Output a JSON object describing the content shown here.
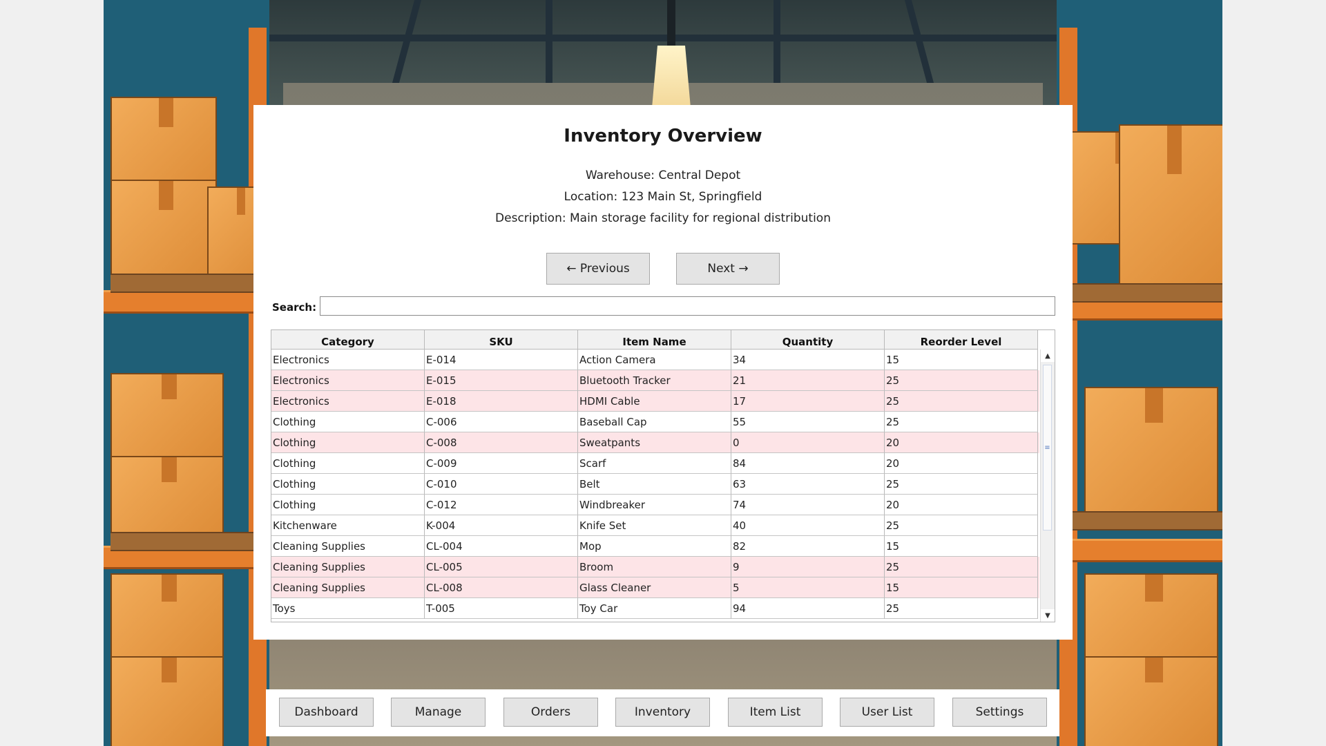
{
  "panel": {
    "title": "Inventory Overview",
    "warehouse": "Warehouse: Central Depot",
    "location": "Location: 123 Main St, Springfield",
    "description": "Description: Main storage facility for regional distribution",
    "prev_label": "← Previous",
    "next_label": "Next →",
    "search_label": "Search:",
    "search_value": ""
  },
  "table": {
    "columns": [
      "Category",
      "SKU",
      "Item Name",
      "Quantity",
      "Reorder Level"
    ],
    "rows": [
      {
        "category": "Electronics",
        "sku": "E-014",
        "name": "Action Camera",
        "qty": "34",
        "reorder": "15",
        "status": "ok"
      },
      {
        "category": "Electronics",
        "sku": "E-015",
        "name": "Bluetooth Tracker",
        "qty": "21",
        "reorder": "25",
        "status": "low"
      },
      {
        "category": "Electronics",
        "sku": "E-018",
        "name": "HDMI Cable",
        "qty": "17",
        "reorder": "25",
        "status": "low"
      },
      {
        "category": "Clothing",
        "sku": "C-006",
        "name": "Baseball Cap",
        "qty": "55",
        "reorder": "25",
        "status": "ok"
      },
      {
        "category": "Clothing",
        "sku": "C-008",
        "name": "Sweatpants",
        "qty": "0",
        "reorder": "20",
        "status": "low"
      },
      {
        "category": "Clothing",
        "sku": "C-009",
        "name": "Scarf",
        "qty": "84",
        "reorder": "20",
        "status": "ok"
      },
      {
        "category": "Clothing",
        "sku": "C-010",
        "name": "Belt",
        "qty": "63",
        "reorder": "25",
        "status": "ok"
      },
      {
        "category": "Clothing",
        "sku": "C-012",
        "name": "Windbreaker",
        "qty": "74",
        "reorder": "20",
        "status": "ok"
      },
      {
        "category": "Kitchenware",
        "sku": "K-004",
        "name": "Knife Set",
        "qty": "40",
        "reorder": "25",
        "status": "ok"
      },
      {
        "category": "Cleaning Supplies",
        "sku": "CL-004",
        "name": "Mop",
        "qty": "82",
        "reorder": "15",
        "status": "ok"
      },
      {
        "category": "Cleaning Supplies",
        "sku": "CL-005",
        "name": "Broom",
        "qty": "9",
        "reorder": "25",
        "status": "low"
      },
      {
        "category": "Cleaning Supplies",
        "sku": "CL-008",
        "name": "Glass Cleaner",
        "qty": "5",
        "reorder": "15",
        "status": "low"
      },
      {
        "category": "Toys",
        "sku": "T-005",
        "name": "Toy Car",
        "qty": "94",
        "reorder": "25",
        "status": "ok"
      }
    ],
    "colors": {
      "low_stock_row": "#fde4e7",
      "normal_row": "#ffffff"
    }
  },
  "nav": {
    "items": [
      "Dashboard",
      "Manage",
      "Orders",
      "Inventory",
      "Item List",
      "User List",
      "Settings"
    ]
  },
  "icons": {
    "scroll_up": "triangle-up-icon",
    "scroll_down": "triangle-down-icon",
    "scroll_grip": "grip-icon"
  }
}
